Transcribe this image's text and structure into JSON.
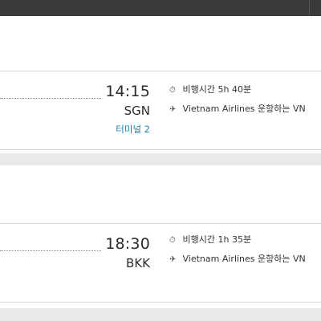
{
  "flights": [
    {
      "arrival_time": "14:15",
      "arrival_airport": "SGN",
      "terminal": "터미널 2",
      "duration_label": "비행시간 5h 40분",
      "operated_by": "Vietnam Airlines 운항하는 VN"
    },
    {
      "arrival_time": "18:30",
      "arrival_airport": "BKK",
      "duration_label": "비행시간 1h 35분",
      "operated_by": "Vietnam Airlines 운항하는 VN"
    }
  ],
  "icons": {
    "duration": "clock-icon",
    "airline": "plane-icon"
  }
}
